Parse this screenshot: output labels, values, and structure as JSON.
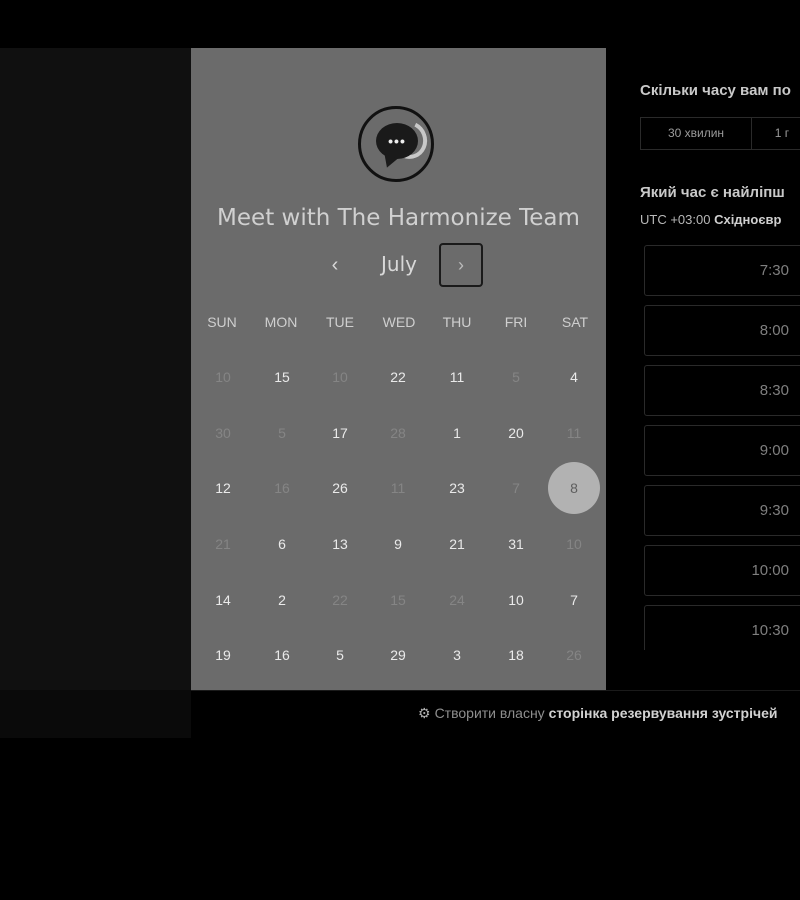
{
  "calendar": {
    "title": "Meet with The Harmonize Team",
    "month": "July",
    "prev_icon": "chevron-left-icon",
    "next_icon": "chevron-right-icon",
    "weekdays": [
      "SUN",
      "MON",
      "TUE",
      "WED",
      "THU",
      "FRI",
      "SAT"
    ],
    "weeks": [
      [
        {
          "v": "10",
          "s": "inactive"
        },
        {
          "v": "15",
          "s": "active"
        },
        {
          "v": "10",
          "s": "inactive"
        },
        {
          "v": "22",
          "s": "active"
        },
        {
          "v": "11",
          "s": "active"
        },
        {
          "v": "5",
          "s": "inactive"
        },
        {
          "v": "4",
          "s": "active"
        }
      ],
      [
        {
          "v": "30",
          "s": "inactive"
        },
        {
          "v": "5",
          "s": "inactive"
        },
        {
          "v": "17",
          "s": "active"
        },
        {
          "v": "28",
          "s": "inactive"
        },
        {
          "v": "1",
          "s": "active"
        },
        {
          "v": "20",
          "s": "active"
        },
        {
          "v": "11",
          "s": "inactive"
        }
      ],
      [
        {
          "v": "12",
          "s": "active"
        },
        {
          "v": "16",
          "s": "inactive"
        },
        {
          "v": "26",
          "s": "active"
        },
        {
          "v": "11",
          "s": "inactive"
        },
        {
          "v": "23",
          "s": "active"
        },
        {
          "v": "7",
          "s": "inactive"
        },
        {
          "v": "8",
          "s": "selected"
        }
      ],
      [
        {
          "v": "21",
          "s": "inactive"
        },
        {
          "v": "6",
          "s": "active"
        },
        {
          "v": "13",
          "s": "active"
        },
        {
          "v": "9",
          "s": "active"
        },
        {
          "v": "21",
          "s": "active"
        },
        {
          "v": "31",
          "s": "active"
        },
        {
          "v": "10",
          "s": "inactive"
        }
      ],
      [
        {
          "v": "14",
          "s": "active"
        },
        {
          "v": "2",
          "s": "active"
        },
        {
          "v": "22",
          "s": "inactive"
        },
        {
          "v": "15",
          "s": "inactive"
        },
        {
          "v": "24",
          "s": "inactive"
        },
        {
          "v": "10",
          "s": "active"
        },
        {
          "v": "7",
          "s": "active"
        }
      ],
      [
        {
          "v": "19",
          "s": "active"
        },
        {
          "v": "16",
          "s": "active"
        },
        {
          "v": "5",
          "s": "active"
        },
        {
          "v": "29",
          "s": "active"
        },
        {
          "v": "3",
          "s": "active"
        },
        {
          "v": "18",
          "s": "active"
        },
        {
          "v": "26",
          "s": "inactive"
        }
      ]
    ]
  },
  "booking": {
    "duration_question": "Скільки часу вам по",
    "durations": [
      "30 хвилин",
      "1 г"
    ],
    "time_question": "Який час є найліпш",
    "timezone_prefix": "UTC +03:00",
    "timezone_name": "Східноєвр",
    "time_slots": [
      "7:30",
      "8:00",
      "8:30",
      "9:00",
      "9:30",
      "10:00",
      "10:30"
    ]
  },
  "footer": {
    "prefix": "Створити власну",
    "link": "сторінка резервування зустрічей",
    "icon": "sprocket-icon"
  },
  "colors": {
    "panel": "#6b6b6b",
    "selected_day": "#b2b2b2"
  }
}
